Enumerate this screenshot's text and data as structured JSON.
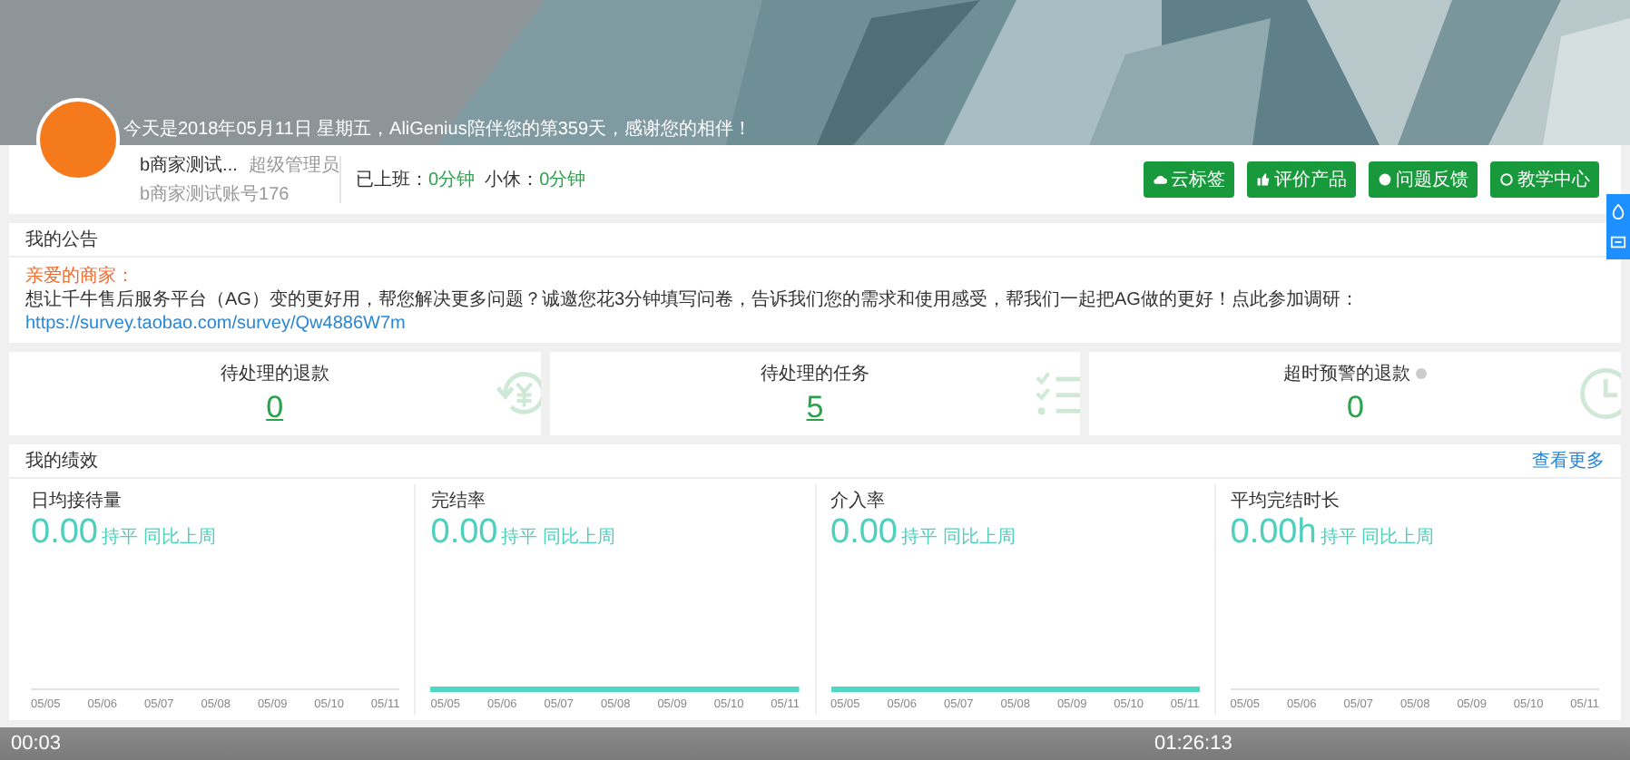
{
  "banner": {
    "greeting": "今天是2018年05月11日 星期五，AliGenius陪伴您的第359天，感谢您的相伴！"
  },
  "profile": {
    "name": "b商家测试...",
    "role": "超级管理员",
    "account": "b商家测试账号176",
    "work_label": "已上班：",
    "work_value": "0分钟",
    "break_label": "小休：",
    "break_value": "0分钟"
  },
  "actions": [
    {
      "label": "云标签"
    },
    {
      "label": "评价产品"
    },
    {
      "label": "问题反馈"
    },
    {
      "label": "教学中心"
    }
  ],
  "notice": {
    "title": "我的公告",
    "salutation": "亲爱的商家：",
    "body": "想让千牛售后服务平台（AG）变的更好用，帮您解决更多问题？诚邀您花3分钟填写问卷，告诉我们您的需求和使用感受，帮我们一起把AG做的更好！点此参加调研：",
    "link": "https://survey.taobao.com/survey/Qw4886W7m"
  },
  "stats": [
    {
      "label": "待处理的退款",
      "value": "0",
      "linked": true,
      "info": false
    },
    {
      "label": "待处理的任务",
      "value": "5",
      "linked": true,
      "info": false
    },
    {
      "label": "超时预警的退款",
      "value": "0",
      "linked": false,
      "info": true
    }
  ],
  "performance": {
    "title": "我的绩效",
    "more": "查看更多",
    "metrics": [
      {
        "label": "日均接待量",
        "value": "0.00",
        "trend": "持平 同比上周",
        "line_shown": false,
        "x_labels": [
          "05/05",
          "05/06",
          "05/07",
          "05/08",
          "05/09",
          "05/10",
          "05/11"
        ]
      },
      {
        "label": "完结率",
        "value": "0.00",
        "trend": "持平 同比上周",
        "line_shown": true,
        "x_labels": [
          "05/05",
          "05/06",
          "05/07",
          "05/08",
          "05/09",
          "05/10",
          "05/11"
        ]
      },
      {
        "label": "介入率",
        "value": "0.00",
        "trend": "持平 同比上周",
        "line_shown": true,
        "x_labels": [
          "05/05",
          "05/06",
          "05/07",
          "05/08",
          "05/09",
          "05/10",
          "05/11"
        ]
      },
      {
        "label": "平均完结时长",
        "value": "0.00h",
        "trend": "持平 同比上周",
        "line_shown": false,
        "x_labels": [
          "05/05",
          "05/06",
          "05/07",
          "05/08",
          "05/09",
          "05/10",
          "05/11"
        ]
      }
    ]
  },
  "player": {
    "elapsed": "00:03",
    "total": "01:26:13"
  }
}
